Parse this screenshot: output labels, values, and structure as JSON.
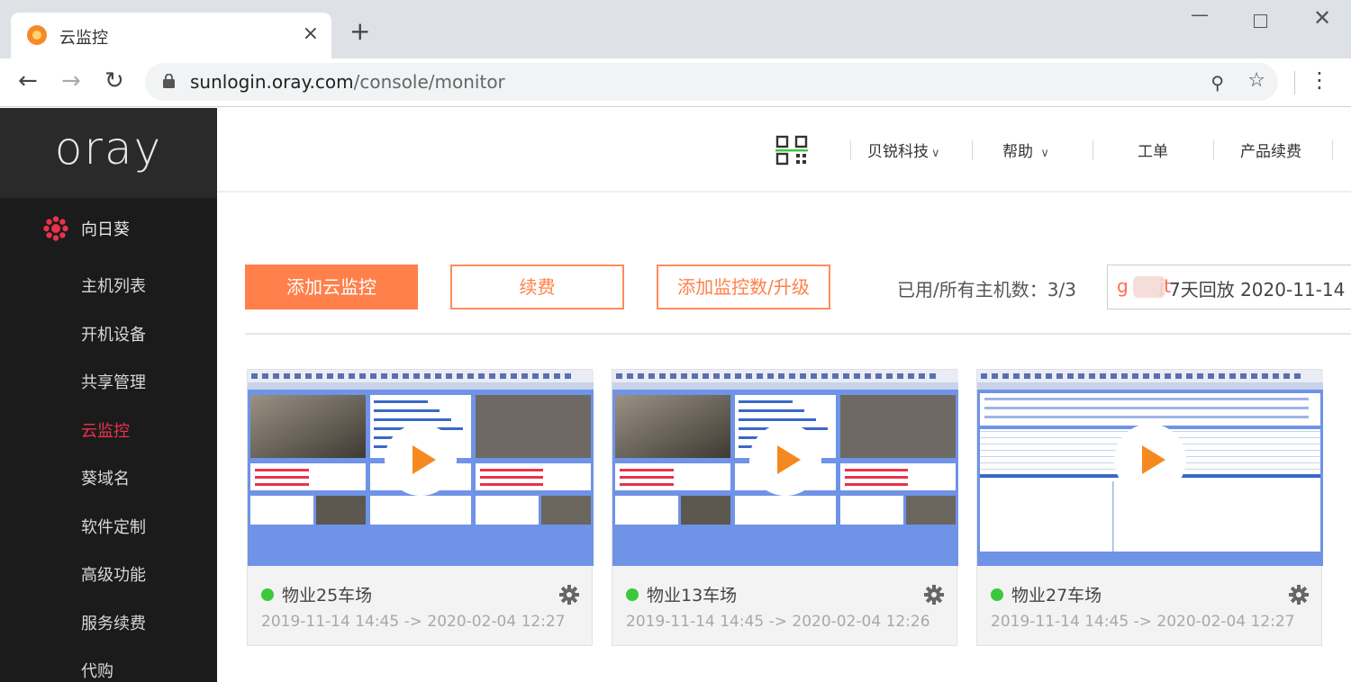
{
  "browser": {
    "tab_title": "云监控",
    "tab_close": "×",
    "new_tab": "+",
    "url_host": "sunlogin.oray.com",
    "url_path": "/console/monitor",
    "win_min": "—",
    "win_close": "✕"
  },
  "sidebar": {
    "logo": "oray",
    "product": "向日葵",
    "items": [
      {
        "label": "主机列表",
        "active": false
      },
      {
        "label": "开机设备",
        "active": false
      },
      {
        "label": "共享管理",
        "active": false
      },
      {
        "label": "云监控",
        "active": true
      },
      {
        "label": "葵域名",
        "active": false
      },
      {
        "label": "软件定制",
        "active": false
      },
      {
        "label": "高级功能",
        "active": false
      },
      {
        "label": "服务续费",
        "active": false
      },
      {
        "label": "代购",
        "active": false
      }
    ]
  },
  "topbar": {
    "company": "贝锐科技",
    "help": "帮助",
    "ticket": "工单",
    "renew": "产品续费",
    "chevron": "∨"
  },
  "actions": {
    "add_monitor": "添加云监控",
    "renew": "续费",
    "upgrade": "添加监控数/升级",
    "host_count": "已用/所有主机数：3/3",
    "plan_prefix": "g",
    "plan_suffix": "jt",
    "plan_text": "7天回放 2020-11-14"
  },
  "cards": [
    {
      "name": "物业25车场",
      "time": "2019-11-14 14:45 -> 2020-02-04 12:27",
      "status": "online"
    },
    {
      "name": "物业13车场",
      "time": "2019-11-14 14:45 -> 2020-02-04 12:26",
      "status": "online"
    },
    {
      "name": "物业27车场",
      "time": "2019-11-14 14:45 -> 2020-02-04 12:27",
      "status": "online"
    }
  ],
  "colors": {
    "accent": "#ff804a",
    "active_nav": "#e8334a",
    "online": "#3cc83c",
    "play": "#f5891f"
  }
}
